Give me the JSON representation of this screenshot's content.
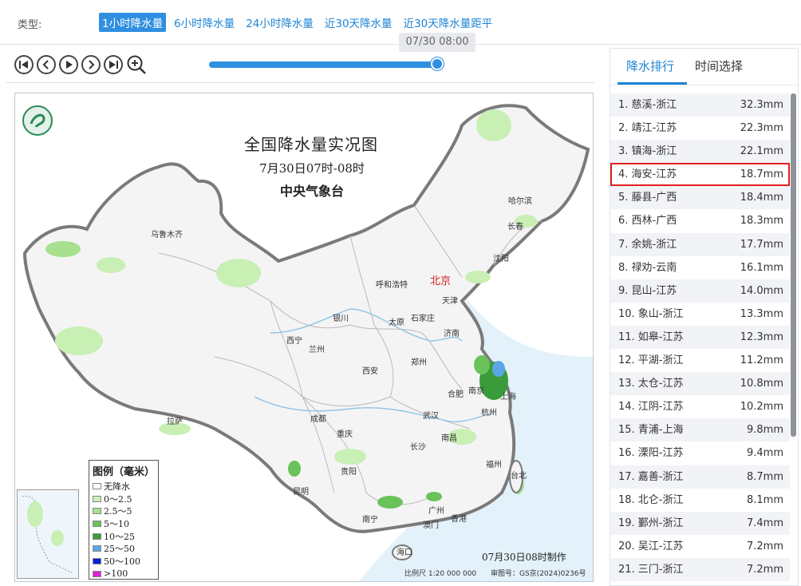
{
  "type_bar": {
    "label": "类型:",
    "tabs": [
      "1小时降水量",
      "6小时降水量",
      "24小时降水量",
      "近30天降水量",
      "近30天降水量距平"
    ],
    "active_index": 0
  },
  "player": {
    "time_tip": "07/30 08:00",
    "progress": 1.0
  },
  "map": {
    "title": "全国降水量实况图",
    "subtitle": "7月30日07时-08时",
    "agency": "中央气象台",
    "capital": "北京",
    "cities": [
      "乌鲁木齐",
      "哈尔滨",
      "长春",
      "沈阳",
      "呼和浩特",
      "天津",
      "银川",
      "太原",
      "石家庄",
      "济南",
      "西宁",
      "兰州",
      "郑州",
      "西安",
      "合肥",
      "南京",
      "上海",
      "杭州",
      "武汉",
      "拉萨",
      "成都",
      "重庆",
      "长沙",
      "南昌",
      "福州",
      "台北",
      "贵阳",
      "昆明",
      "广州",
      "香港",
      "澳门",
      "南宁",
      "海口"
    ],
    "legend": {
      "title": "图例（毫米）",
      "items": [
        {
          "label": "无降水",
          "color": "#ffffff"
        },
        {
          "label": "0～2.5",
          "color": "#c8efb4"
        },
        {
          "label": "2.5～5",
          "color": "#a7e08e"
        },
        {
          "label": "5～10",
          "color": "#69c25a"
        },
        {
          "label": "10～25",
          "color": "#3a9b3a"
        },
        {
          "label": "25～50",
          "color": "#5aa7e6"
        },
        {
          "label": "50～100",
          "color": "#0a1fd6"
        },
        {
          "label": ">100",
          "color": "#e020d8"
        }
      ]
    },
    "made_note": "07月30日08时制作",
    "scale": "比例尺 1:20 000 000",
    "review_no": "审图号：GS京(2024)0236号"
  },
  "panel": {
    "tabs": [
      "降水排行",
      "时间选择"
    ],
    "active_tab": 0,
    "highlight_index": 3,
    "rankings": [
      {
        "name": "1. 慈溪-浙江",
        "value": "32.3mm"
      },
      {
        "name": "2. 靖江-江苏",
        "value": "22.3mm"
      },
      {
        "name": "3. 镇海-浙江",
        "value": "22.1mm"
      },
      {
        "name": "4. 海安-江苏",
        "value": "18.7mm"
      },
      {
        "name": "5. 藤县-广西",
        "value": "18.4mm"
      },
      {
        "name": "6. 西林-广西",
        "value": "18.3mm"
      },
      {
        "name": "7. 余姚-浙江",
        "value": "17.7mm"
      },
      {
        "name": "8. 禄劝-云南",
        "value": "16.1mm"
      },
      {
        "name": "9. 昆山-江苏",
        "value": "14.0mm"
      },
      {
        "name": "10. 象山-浙江",
        "value": "13.3mm"
      },
      {
        "name": "11. 如皋-江苏",
        "value": "12.3mm"
      },
      {
        "name": "12. 平湖-浙江",
        "value": "11.2mm"
      },
      {
        "name": "13. 太仓-江苏",
        "value": "10.8mm"
      },
      {
        "name": "14. 江阴-江苏",
        "value": "10.2mm"
      },
      {
        "name": "15. 青浦-上海",
        "value": "9.8mm"
      },
      {
        "name": "16. 溧阳-江苏",
        "value": "9.4mm"
      },
      {
        "name": "17. 嘉善-浙江",
        "value": "8.7mm"
      },
      {
        "name": "18. 北仑-浙江",
        "value": "8.1mm"
      },
      {
        "name": "19. 鄞州-浙江",
        "value": "7.4mm"
      },
      {
        "name": "20. 吴江-江苏",
        "value": "7.2mm"
      },
      {
        "name": "21. 三门-浙江",
        "value": "7.2mm"
      }
    ]
  }
}
